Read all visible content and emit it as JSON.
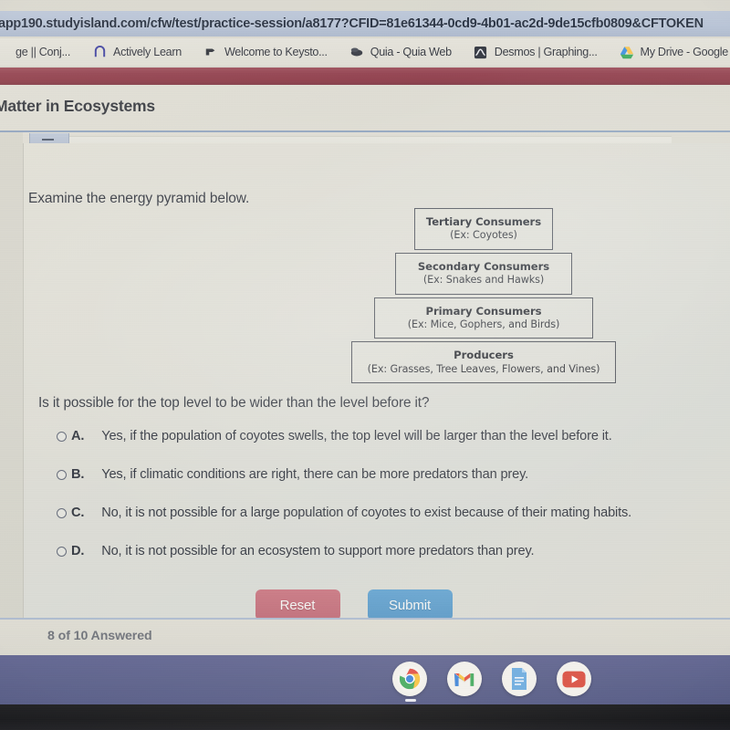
{
  "browser": {
    "url": "app190.studyisland.com/cfw/test/practice-session/a8177?CFID=81e61344-0cd9-4b01-ac2d-9de15cfb0809&CFTOKEN",
    "bookmarks": [
      {
        "label": "ge || Conj...",
        "icon": "bookmark-generic-icon"
      },
      {
        "label": "Actively Learn",
        "icon": "actively-learn-icon"
      },
      {
        "label": "Welcome to Keysto...",
        "icon": "keystone-icon"
      },
      {
        "label": "Quia - Quia Web",
        "icon": "quia-icon"
      },
      {
        "label": "Desmos | Graphing...",
        "icon": "desmos-icon"
      },
      {
        "label": "My Drive - Google D",
        "icon": "google-drive-icon"
      }
    ]
  },
  "page": {
    "title": "Matter in Ecosystems",
    "prompt": "Examine the energy pyramid below.",
    "question": "Is it possible for the top level to be wider than the level before it?"
  },
  "pyramid": {
    "tiers": [
      {
        "title": "Tertiary Consumers",
        "example": "(Ex: Coyotes)"
      },
      {
        "title": "Secondary Consumers",
        "example": "(Ex: Snakes and Hawks)"
      },
      {
        "title": "Primary Consumers",
        "example": "(Ex: Mice, Gophers, and Birds)"
      },
      {
        "title": "Producers",
        "example": "(Ex: Grasses, Tree Leaves, Flowers, and Vines)"
      }
    ]
  },
  "choices": [
    {
      "letter": "A.",
      "text": "Yes, if the population of coyotes swells, the top level will be larger than the level before it.",
      "selected": false
    },
    {
      "letter": "B.",
      "text": "Yes, if climatic conditions are right, there can be more predators than prey.",
      "selected": false
    },
    {
      "letter": "C.",
      "text": "No, it is not possible for a large population of coyotes to exist because of their mating habits.",
      "selected": false
    },
    {
      "letter": "D.",
      "text": "No, it is not possible for an ecosystem to support more predators than prey.",
      "selected": false
    }
  ],
  "actions": {
    "reset_label": "Reset",
    "submit_label": "Submit",
    "reset_color": "#bc6672",
    "submit_color": "#5293c3"
  },
  "footer": {
    "progress": "8 of 10 Answered",
    "answered": 8,
    "total": 10
  },
  "shelf": {
    "apps": [
      {
        "name": "chrome-icon",
        "label": "Google Chrome"
      },
      {
        "name": "gmail-icon",
        "label": "Gmail"
      },
      {
        "name": "docs-icon",
        "label": "Google Docs"
      },
      {
        "name": "youtube-icon",
        "label": "YouTube"
      }
    ]
  },
  "colors": {
    "header_band": "#8a3643",
    "page_bg": "#dcdad0",
    "shelf": "#555a85"
  }
}
